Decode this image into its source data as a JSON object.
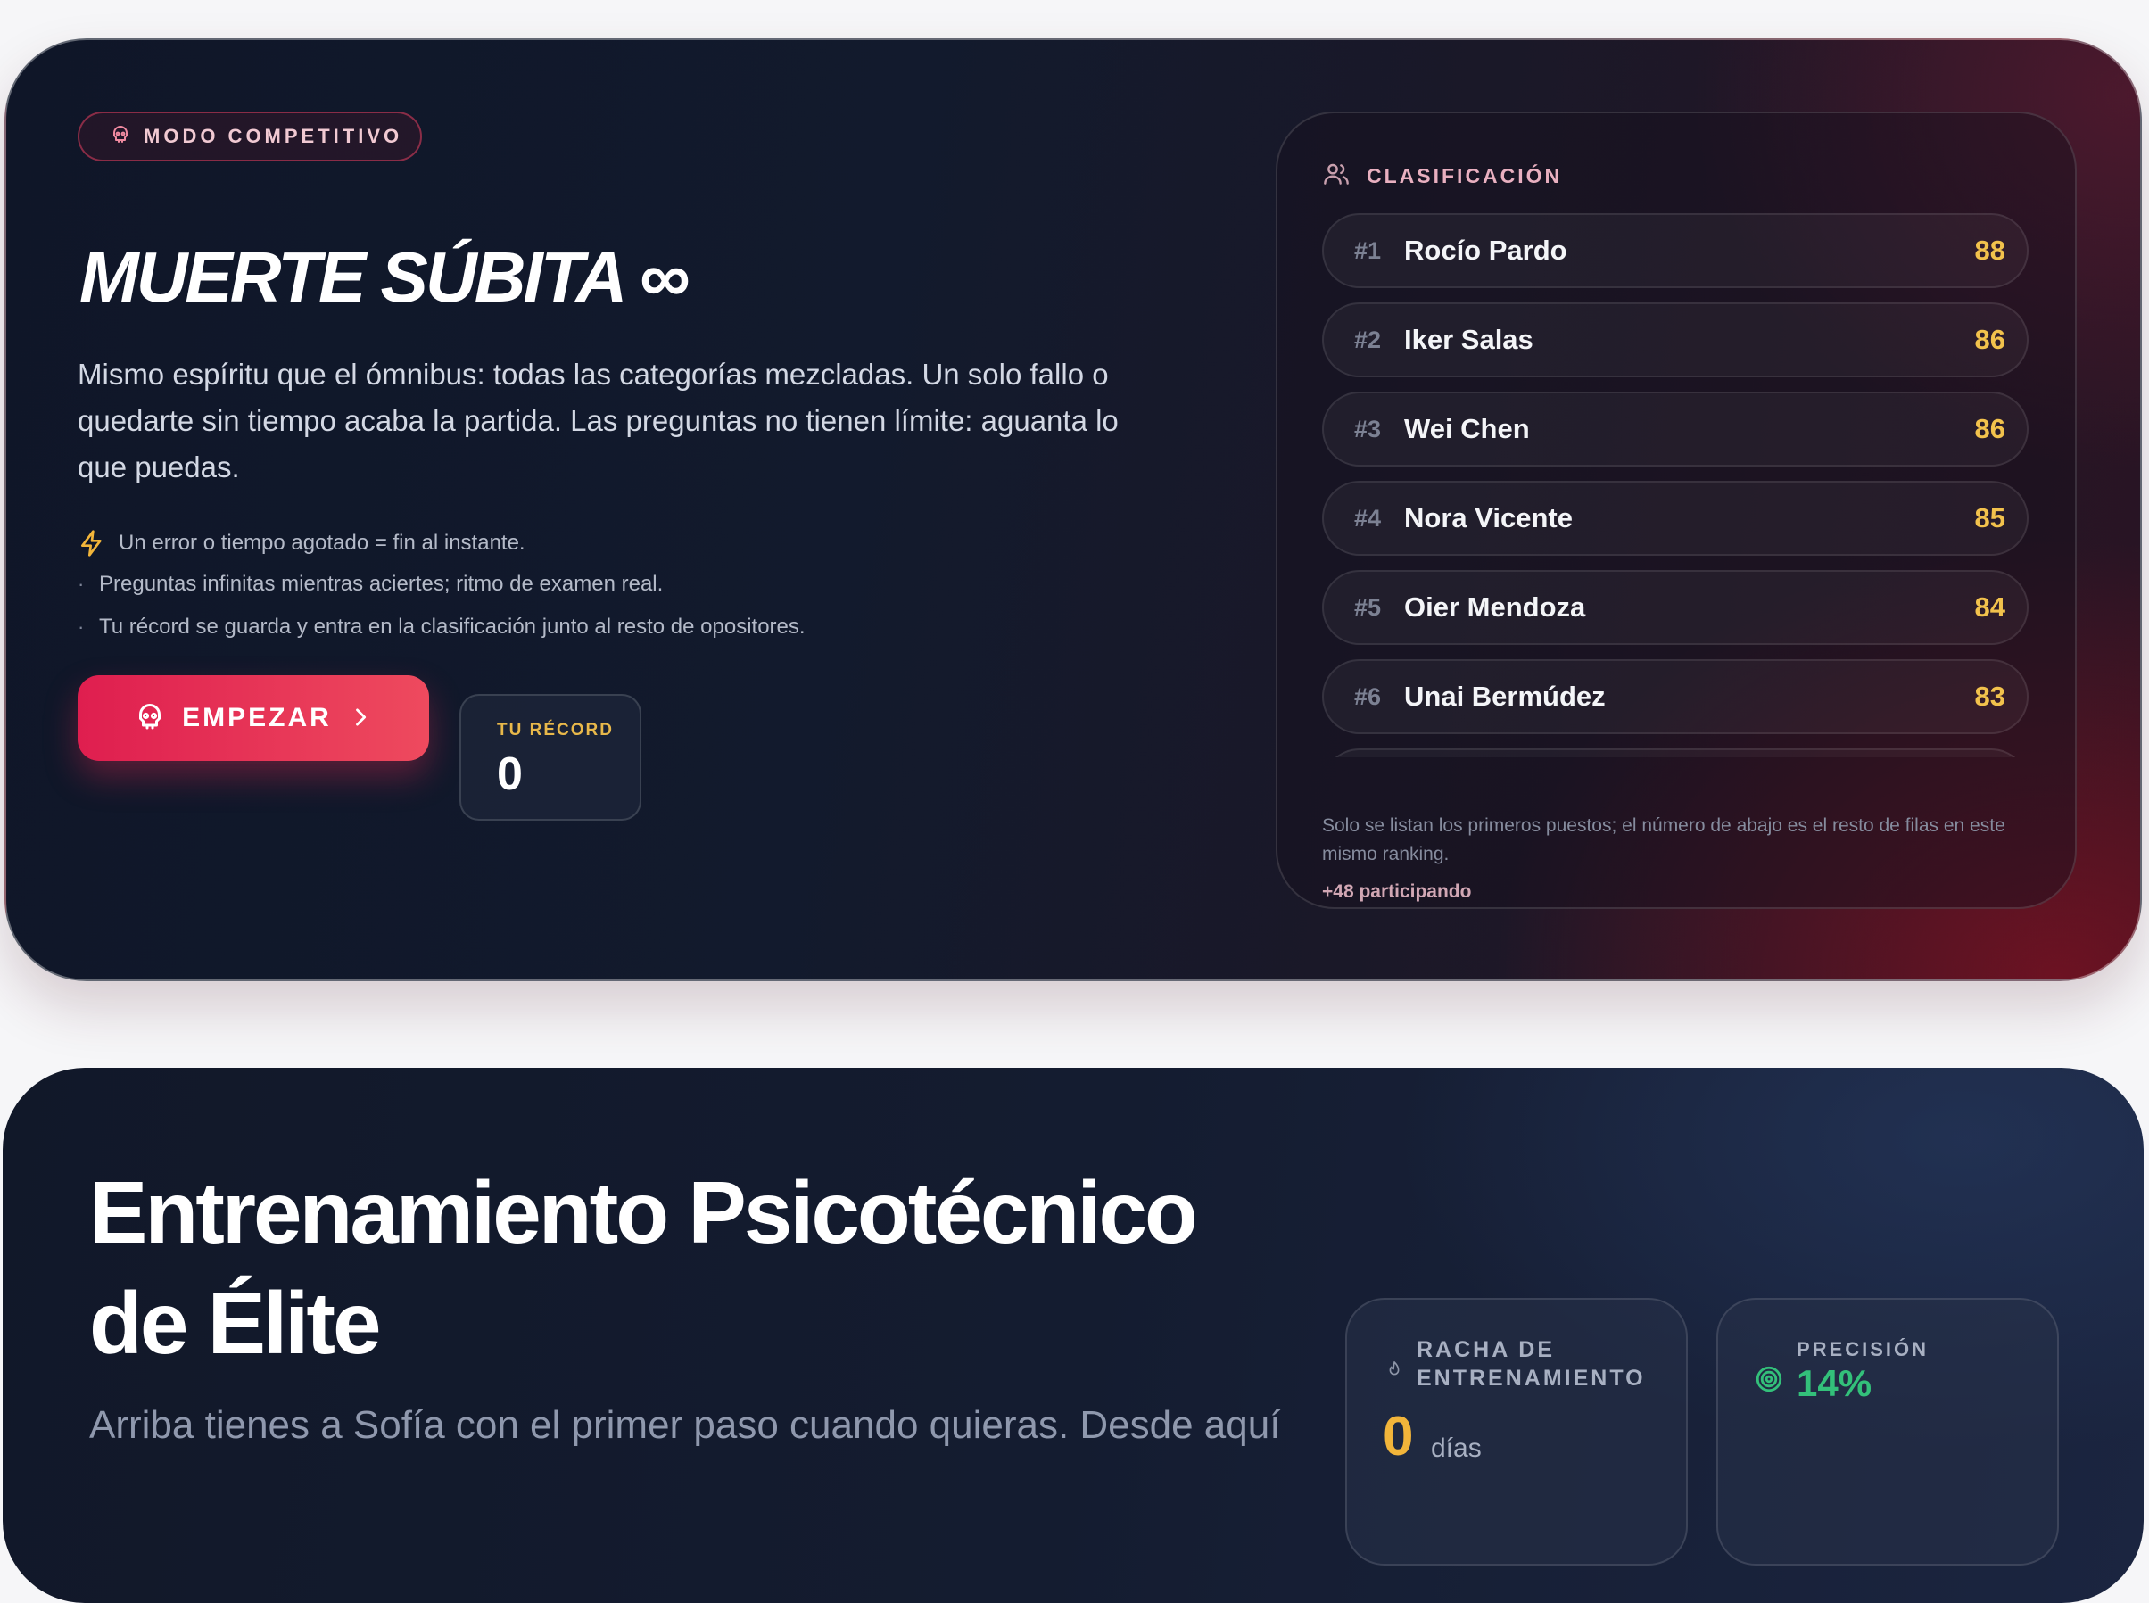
{
  "competitive": {
    "badge": "MODO COMPETITIVO",
    "title": "MUERTE SÚBITA ∞",
    "description": "Mismo espíritu que el ómnibus: todas las categorías mezcladas. Un solo fallo o quedarte sin tiempo acaba la partida. Las preguntas no tienen límite: aguanta lo que puedas.",
    "rules": [
      "Un error o tiempo agotado = fin al instante.",
      "Preguntas infinitas mientras aciertes; ritmo de examen real.",
      "Tu récord se guarda y entra en la clasificación junto al resto de opositores."
    ],
    "start_label": "EMPEZAR",
    "record_label": "TU RÉCORD",
    "record_value": "0",
    "accent_color": "#e8305a"
  },
  "leaderboard": {
    "title": "CLASIFICACIÓN",
    "rows": [
      {
        "rank": "#1",
        "name": "Rocío Pardo",
        "score": "88"
      },
      {
        "rank": "#2",
        "name": "Iker Salas",
        "score": "86"
      },
      {
        "rank": "#3",
        "name": "Wei Chen",
        "score": "86"
      },
      {
        "rank": "#4",
        "name": "Nora Vicente",
        "score": "85"
      },
      {
        "rank": "#5",
        "name": "Oier Mendoza",
        "score": "84"
      },
      {
        "rank": "#6",
        "name": "Unai Bermúdez",
        "score": "83"
      }
    ],
    "note": "Solo se listan los primeros puestos; el número de abajo es el resto de filas en este mismo ranking.",
    "participants": "+48 participando"
  },
  "training": {
    "title_line1": "Entrenamiento Psicotécnico",
    "title_line2": "de Élite",
    "description": "Arriba tienes a Sofía con el primer paso cuando quieras. Desde aquí",
    "streak": {
      "label": "RACHA DE ENTRENAMIENTO",
      "value": "0",
      "unit": "días",
      "icon": "flame-icon"
    },
    "precision": {
      "label": "PRECISIÓN",
      "value": "14%",
      "icon": "target-icon"
    }
  }
}
